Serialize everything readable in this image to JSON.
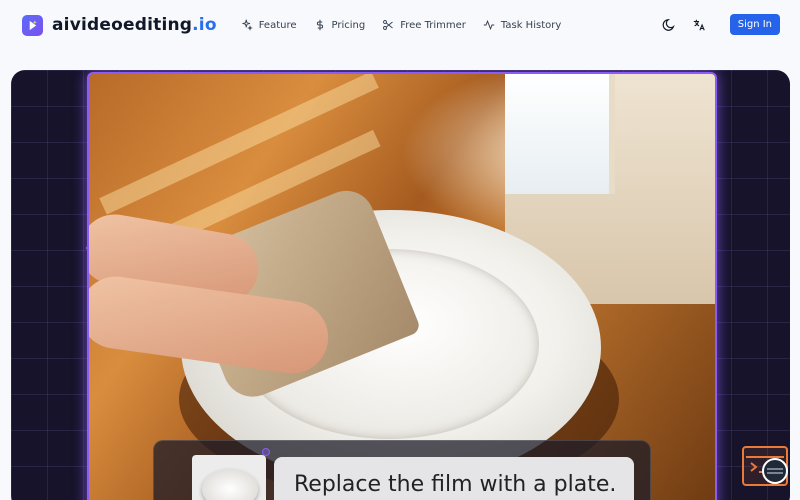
{
  "brand": {
    "name": "aivideoediting",
    "tld": ".io"
  },
  "nav": {
    "items": [
      {
        "label": "Feature",
        "icon": "sparkles-icon"
      },
      {
        "label": "Pricing",
        "icon": "dollar-icon"
      },
      {
        "label": "Free Trimmer",
        "icon": "scissors-icon"
      },
      {
        "label": "Task History",
        "icon": "activity-icon"
      }
    ]
  },
  "tools": {
    "theme_icon": "moon-icon",
    "language_icon": "translate-icon"
  },
  "auth": {
    "signin_label": "Sign In"
  },
  "hero": {
    "caption": "Replace the film with a plate."
  },
  "colors": {
    "accent": "#2563eb",
    "frame": "#8b5cf6",
    "brand_tld": "#2a6ef0"
  }
}
